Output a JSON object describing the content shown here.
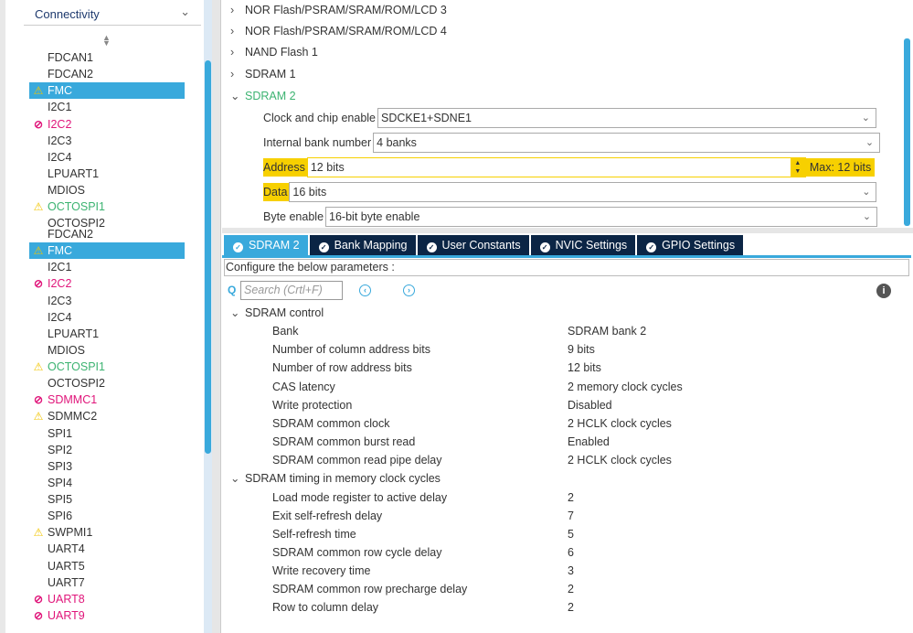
{
  "sidebar": {
    "category": "Connectivity",
    "list_a": [
      {
        "label": "FDCAN1",
        "state": "none"
      },
      {
        "label": "FDCAN2",
        "state": "none"
      },
      {
        "label": "FMC",
        "state": "selected-warn"
      },
      {
        "label": "I2C1",
        "state": "none"
      },
      {
        "label": "I2C2",
        "state": "error"
      },
      {
        "label": "I2C3",
        "state": "none"
      },
      {
        "label": "I2C4",
        "state": "none"
      },
      {
        "label": "LPUART1",
        "state": "none"
      },
      {
        "label": "MDIOS",
        "state": "none"
      },
      {
        "label": "OCTOSPI1",
        "state": "warn"
      },
      {
        "label": "OCTOSPI2",
        "state": "none"
      }
    ],
    "list_b": [
      {
        "label": "FDCAN2",
        "state": "none"
      },
      {
        "label": "FMC",
        "state": "selected-warn"
      },
      {
        "label": "I2C1",
        "state": "none"
      },
      {
        "label": "I2C2",
        "state": "error"
      },
      {
        "label": "I2C3",
        "state": "none"
      },
      {
        "label": "I2C4",
        "state": "none"
      },
      {
        "label": "LPUART1",
        "state": "none"
      },
      {
        "label": "MDIOS",
        "state": "none"
      },
      {
        "label": "OCTOSPI1",
        "state": "warn"
      },
      {
        "label": "OCTOSPI2",
        "state": "none"
      },
      {
        "label": "SDMMC1",
        "state": "error"
      },
      {
        "label": "SDMMC2",
        "state": "warn-plain"
      },
      {
        "label": "SPI1",
        "state": "none"
      },
      {
        "label": "SPI2",
        "state": "none"
      },
      {
        "label": "SPI3",
        "state": "none"
      },
      {
        "label": "SPI4",
        "state": "none"
      },
      {
        "label": "SPI5",
        "state": "none"
      },
      {
        "label": "SPI6",
        "state": "none"
      },
      {
        "label": "SWPMI1",
        "state": "warn-plain"
      },
      {
        "label": "UART4",
        "state": "none"
      },
      {
        "label": "UART5",
        "state": "none"
      },
      {
        "label": "UART7",
        "state": "none"
      },
      {
        "label": "UART8",
        "state": "error"
      },
      {
        "label": "UART9",
        "state": "error"
      }
    ]
  },
  "tree": [
    "NOR Flash/PSRAM/SRAM/ROM/LCD 3",
    "NOR Flash/PSRAM/SRAM/ROM/LCD 4",
    "NAND Flash 1",
    "SDRAM 1",
    "SDRAM 2"
  ],
  "fields": {
    "clock": {
      "label": "Clock and chip enable",
      "value": "SDCKE1+SDNE1"
    },
    "banks": {
      "label": "Internal bank number",
      "value": "4 banks"
    },
    "address": {
      "label": "Address",
      "value": "12 bits",
      "max": "Max: 12 bits"
    },
    "data": {
      "label": "Data",
      "value": "16 bits"
    },
    "byte": {
      "label": "Byte enable",
      "value": "16-bit byte enable"
    }
  },
  "tabs": [
    "SDRAM 2",
    "Bank Mapping",
    "User Constants",
    "NVIC Settings",
    "GPIO Settings"
  ],
  "config_label": "Configure the below parameters :",
  "search_placeholder": "Search (Crtl+F)",
  "params": [
    {
      "group": "SDRAM control"
    },
    {
      "name": "Bank",
      "value": "SDRAM bank 2"
    },
    {
      "name": "Number of column address bits",
      "value": "9 bits"
    },
    {
      "name": "Number of row address bits",
      "value": "12 bits"
    },
    {
      "name": "CAS latency",
      "value": "2 memory clock cycles"
    },
    {
      "name": "Write protection",
      "value": "Disabled"
    },
    {
      "name": "SDRAM common clock",
      "value": "2 HCLK clock cycles"
    },
    {
      "name": "SDRAM common burst read",
      "value": "Enabled"
    },
    {
      "name": "SDRAM common read pipe delay",
      "value": "2 HCLK clock cycles"
    },
    {
      "group": "SDRAM timing in memory clock cycles"
    },
    {
      "name": "Load mode register to active delay",
      "value": "2"
    },
    {
      "name": "Exit self-refresh delay",
      "value": "7"
    },
    {
      "name": "Self-refresh time",
      "value": "5"
    },
    {
      "name": "SDRAM common row cycle delay",
      "value": "6"
    },
    {
      "name": "Write recovery time",
      "value": "3"
    },
    {
      "name": "SDRAM common row precharge delay",
      "value": "2"
    },
    {
      "name": "Row to column delay",
      "value": "2"
    }
  ]
}
